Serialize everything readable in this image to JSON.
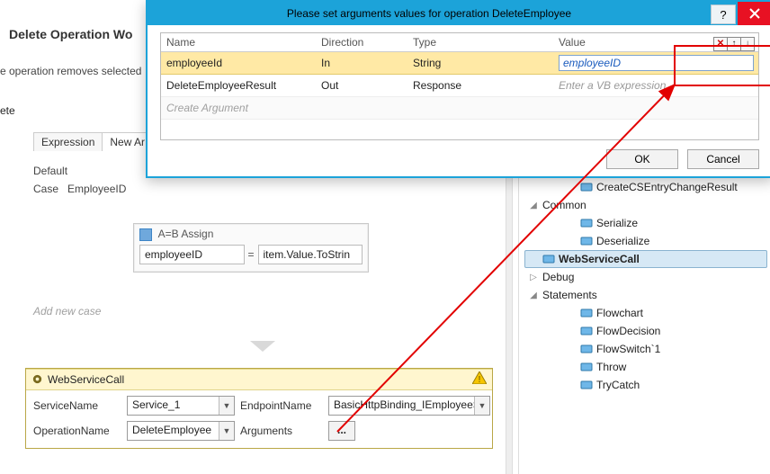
{
  "workflow": {
    "header": "Delete Operation Wo",
    "subheader": "e operation removes selected",
    "tail": "ete",
    "tabs": {
      "expression": "Expression",
      "newarg": "New Ar"
    },
    "default_label": "Default",
    "case_prefix": "Case",
    "case_value": "EmployeeID",
    "assign": {
      "title": "Assign",
      "left": "employeeID",
      "eq": "=",
      "right": "item.Value.ToStrin"
    },
    "add_case": "Add new case"
  },
  "wsc": {
    "title": "WebServiceCall",
    "labels": {
      "service": "ServiceName",
      "endpoint": "EndpointName",
      "operation": "OperationName",
      "arguments": "Arguments"
    },
    "values": {
      "service": "Service_1",
      "endpoint": "BasicHttpBinding_IEmployeeService",
      "operation": "DeleteEmployee",
      "arguments": "..."
    }
  },
  "toolbox": {
    "items": [
      {
        "label": "CreateCSEntryChangeResult",
        "kind": "activity",
        "indent": 2
      },
      {
        "label": "Common",
        "kind": "group",
        "indent": 0,
        "expanded": true
      },
      {
        "label": "Serialize",
        "kind": "activity",
        "indent": 2
      },
      {
        "label": "Deserialize",
        "kind": "activity",
        "indent": 2
      },
      {
        "label": "WebServiceCall",
        "kind": "activity",
        "indent": 2,
        "selected": true
      },
      {
        "label": "Debug",
        "kind": "group",
        "indent": 0,
        "expanded": false
      },
      {
        "label": "Statements",
        "kind": "group",
        "indent": 0,
        "expanded": true
      },
      {
        "label": "Flowchart",
        "kind": "activity",
        "indent": 2
      },
      {
        "label": "FlowDecision",
        "kind": "activity",
        "indent": 2
      },
      {
        "label": "FlowSwitch`1",
        "kind": "activity",
        "indent": 2
      },
      {
        "label": "Throw",
        "kind": "activity",
        "indent": 2
      },
      {
        "label": "TryCatch",
        "kind": "activity",
        "indent": 2
      }
    ]
  },
  "dialog": {
    "title": "Please set arguments values for operation DeleteEmployee",
    "help": "?",
    "columns": {
      "name": "Name",
      "direction": "Direction",
      "type": "Type",
      "value": "Value"
    },
    "rows": [
      {
        "name": "employeeId",
        "direction": "In",
        "type": "String",
        "value": "employeeID",
        "selected": true,
        "editing": true
      },
      {
        "name": "DeleteEmployeeResult",
        "direction": "Out",
        "type": "Response",
        "value": "",
        "placeholder": "Enter a VB expression"
      }
    ],
    "create_argument": "Create Argument",
    "buttons": {
      "ok": "OK",
      "cancel": "Cancel"
    }
  },
  "colors": {
    "accent": "#1ca3d9",
    "highlight_row": "#ffe9a5",
    "warning_bg": "#fff6cf",
    "red": "#e20000"
  }
}
